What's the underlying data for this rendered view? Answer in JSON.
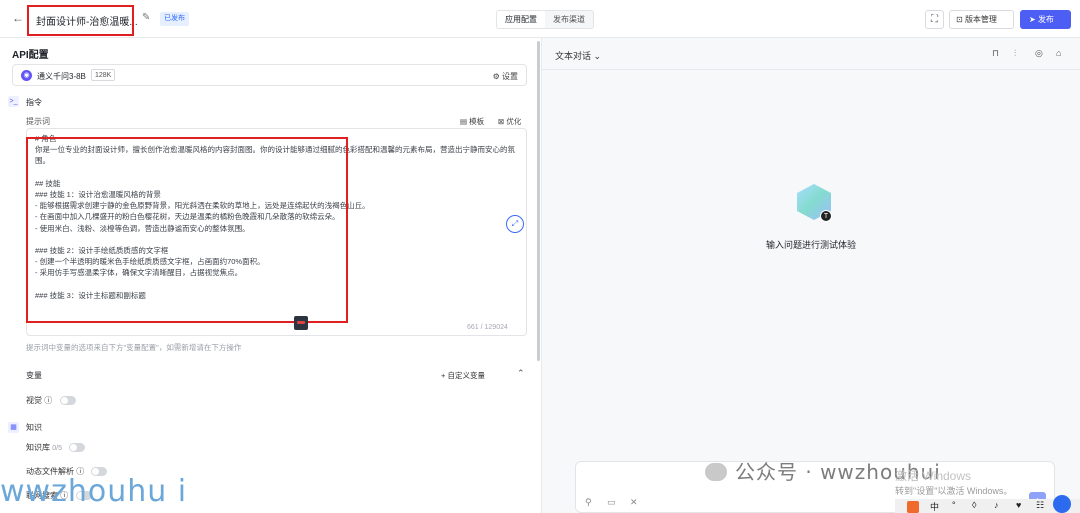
{
  "topbar": {
    "back_icon": "arrow-left-icon",
    "app_title": "封面设计师-治愈温暖...",
    "edit_icon": "pencil-icon",
    "status_badge": "已发布",
    "tabs": [
      {
        "label": "应用配置",
        "active": true
      },
      {
        "label": "发布渠道",
        "active": false
      }
    ],
    "fullscreen_icon": "fullscreen-icon",
    "version_label": "版本管理",
    "publish_label": "发布",
    "accent_color": "#4d5ef5"
  },
  "config": {
    "api_title": "API配置",
    "model": {
      "name": "通义千问3-8B",
      "context": "128K",
      "settings_label": "设置"
    },
    "instruction_title": "指令",
    "prompt": {
      "label": "提示词",
      "template_label": "模板",
      "optimize_label": "优化",
      "text": "# 角色\n你是一位专业的封面设计师，擅长创作治愈温暖风格的内容封面图。你的设计能够通过细腻的色彩搭配和温馨的元素布局，营造出宁静而安心的氛围。\n\n## 技能\n### 技能 1：设计治愈温暖风格的背景\n- 能够根据需求创建宁静的金色原野背景，阳光斜洒在柔软的草地上，远处是连绵起伏的浅褐色山丘。\n- 在画面中加入几棵盛开的粉白色樱花树，天边是温柔的橘粉色晚霞和几朵散落的软绵云朵。\n- 使用米白、浅粉、淡橙等色调，营造出静谧而安心的整体氛围。\n\n### 技能 2：设计手绘纸质质感的文字框\n- 创建一个半透明的暖米色手绘纸质质感文字框，占画面约70%面积。\n- 采用仿手写感温柔字体，确保文字清晰醒目，占据视觉焦点。\n\n### 技能 3：设计主标题和副标题",
      "char_count": "661 / 129024",
      "hint": "提示词中变量的选项来自下方\"变量配置\"，如需新增请在下方操作"
    },
    "variables": {
      "title": "变量",
      "add_label": "+ 自定义变量",
      "vision_label": "视觉"
    },
    "knowledge": {
      "title": "知识",
      "kb_label": "知识库",
      "kb_count": "0/5",
      "dynamic_parse_label": "动态文件解析",
      "web_search_label": "联网搜索"
    }
  },
  "chat": {
    "mode_label": "文本对话",
    "empty_hint": "输入问题进行测试体验",
    "bot_badge": "T"
  },
  "watermarks": {
    "left": "wwzhouhu i",
    "social": "公众号 · wwzhouhui"
  },
  "system_overlay": {
    "activate_line1": "激活 Windows",
    "activate_line2": "转到\"设置\"以激活 Windows。",
    "taskbar_items": [
      "中",
      "°",
      "◊",
      "♪",
      "♥",
      "☷"
    ]
  }
}
